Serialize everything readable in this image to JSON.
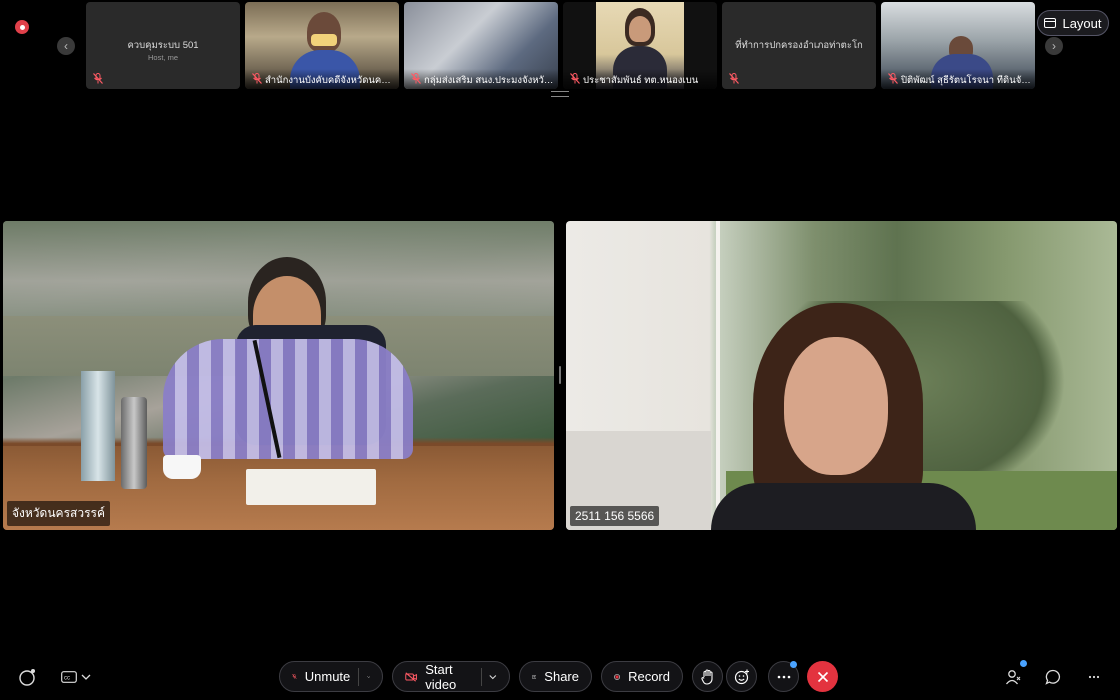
{
  "recording_indicator": "recording",
  "strip": {
    "prev_icon": "chevron-left-icon",
    "next_icon": "chevron-right-icon",
    "thumbnails": [
      {
        "id": "host",
        "center_label": "ควบคุมระบบ 501",
        "sub_label": "Host, me",
        "name": "",
        "muted": true
      },
      {
        "id": "p2",
        "center_label": "",
        "sub_label": "",
        "name": "สำนักงานบังคับคดีจังหวัดนครสว...",
        "muted": true
      },
      {
        "id": "p3",
        "center_label": "",
        "sub_label": "",
        "name": "กลุ่มส่งเสริม สนง.ประมงจังหวัดน...",
        "muted": true
      },
      {
        "id": "p4",
        "center_label": "",
        "sub_label": "",
        "name": "ประชาสัมพันธ์ ทต.หนองเบน",
        "muted": true
      },
      {
        "id": "p5",
        "center_label": "ที่ทำการปกครองอำเภอท่าตะโก",
        "sub_label": "",
        "name": "",
        "muted": true
      },
      {
        "id": "p6",
        "center_label": "",
        "sub_label": "",
        "name": "ปิติพัฒน์ สุธีรัตนโรจนา ทีดินจังห...",
        "muted": true
      }
    ]
  },
  "layout_button": {
    "label": "Layout",
    "icon": "layout-icon"
  },
  "main_videos": [
    {
      "label": "จังหวัดนครสวรรค์"
    },
    {
      "label": "2511 156 5566"
    }
  ],
  "toolbar": {
    "unmute": {
      "label": "Unmute",
      "icon": "microphone-muted-icon"
    },
    "start_video": {
      "label": "Start video",
      "icon": "camera-off-icon"
    },
    "share": {
      "label": "Share",
      "icon": "share-icon"
    },
    "record": {
      "label": "Record",
      "icon": "record-icon"
    },
    "raise_hand_icon": "raise-hand-icon",
    "reactions_icon": "emoji-icon",
    "more_icon": "more-icon",
    "leave_icon": "close-icon",
    "participants_icon": "participants-icon",
    "chat_icon": "chat-icon",
    "overflow_icon": "more-icon"
  },
  "colors": {
    "leave": "#e3333f",
    "record_dot": "#e3333f",
    "badge": "#4aa3ff",
    "accent": "#e0404a"
  }
}
